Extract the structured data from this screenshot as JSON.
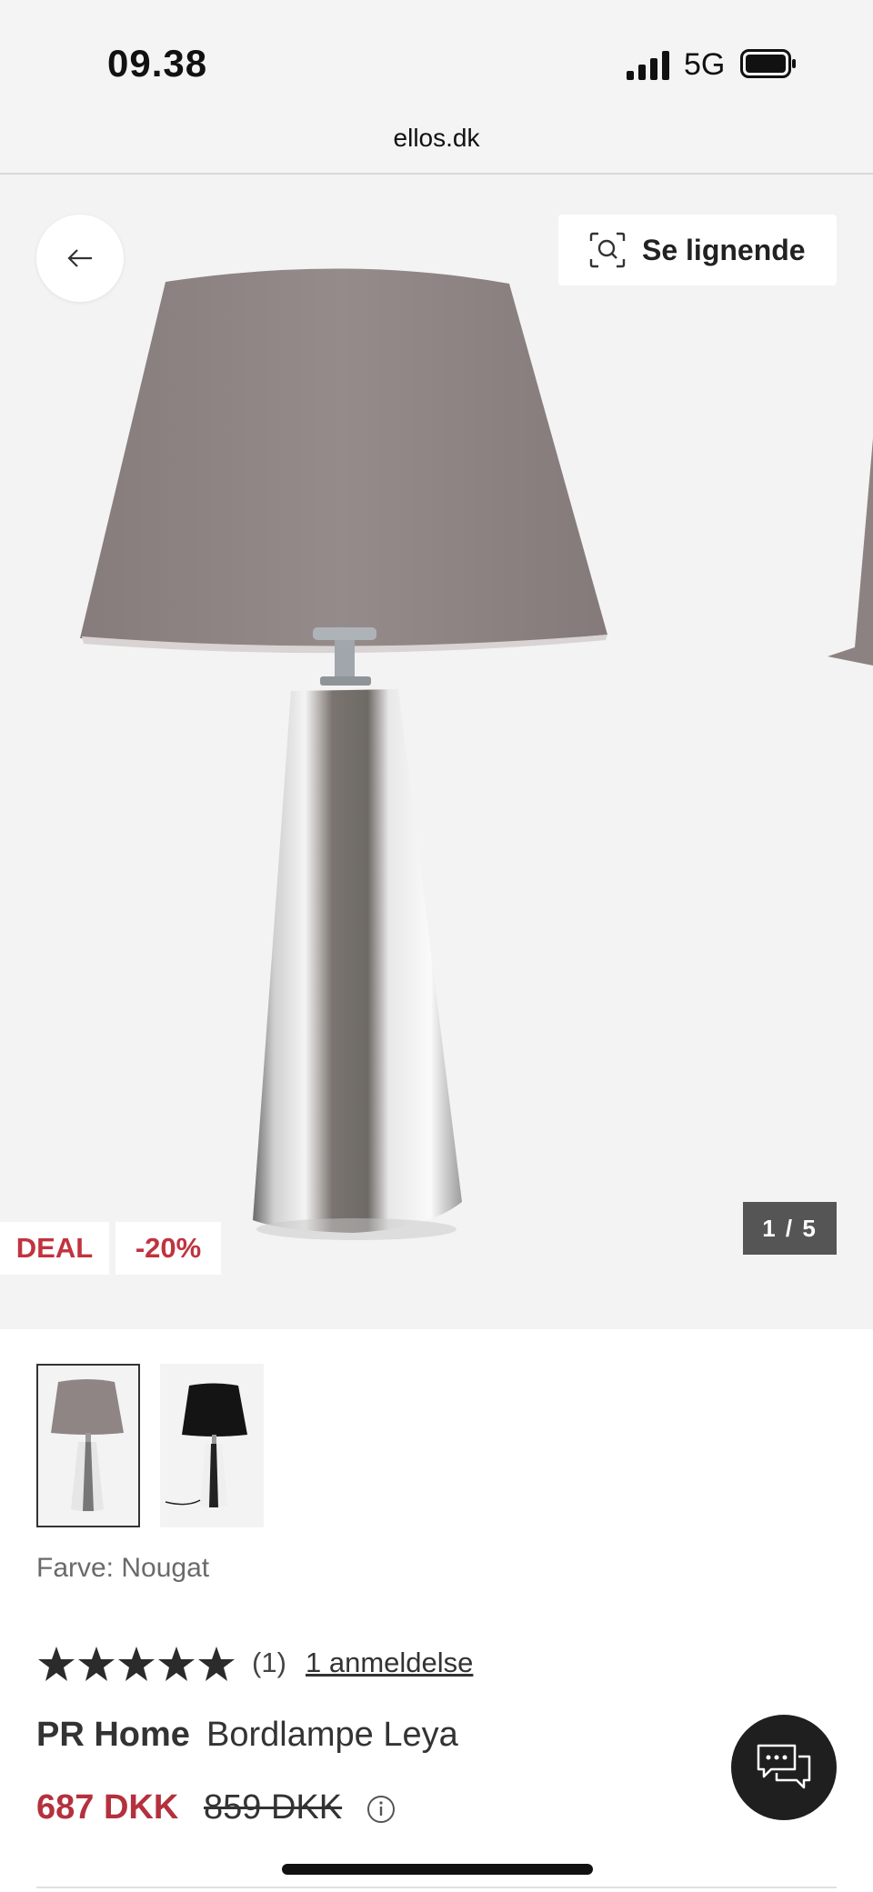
{
  "status_bar": {
    "time": "09.38",
    "network": "5G",
    "signal_icon": "signal-bars-icon",
    "battery_icon": "battery-icon"
  },
  "browser": {
    "url": "ellos.dk"
  },
  "hero": {
    "back_icon": "arrow-left-icon",
    "similar_button": {
      "icon": "visual-search-icon",
      "label": "Se lignende"
    },
    "badges": {
      "deal": "DEAL",
      "discount": "-20%"
    },
    "counter": "1 / 5",
    "colors": {
      "shade": "#8f8585",
      "badge_text": "#c0333f"
    }
  },
  "gallery": {
    "thumbnails": [
      "nougat-lamp-thumbnail",
      "black-lamp-thumbnail"
    ],
    "selected": 1
  },
  "product": {
    "color_label": "Farve: Nougat",
    "rating": {
      "stars": 5,
      "count_text": "(1)",
      "reviews_link": "1 anmeldelse"
    },
    "brand": "PR Home",
    "name": "Bordlampe Leya",
    "price_now": "687 DKK",
    "price_was": "859 DKK",
    "price_color": "#b5303d"
  },
  "chat": {
    "icon": "chat-bubbles-icon"
  }
}
